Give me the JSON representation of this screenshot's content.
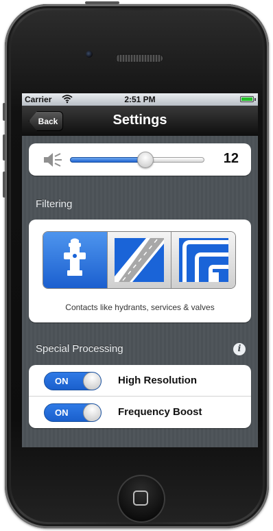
{
  "status_bar": {
    "carrier": "Carrier",
    "time": "2:51 PM",
    "wifi_icon": "wifi-icon",
    "battery_level": 1.0,
    "battery_color": "#26c02a"
  },
  "nav_bar": {
    "back_label": "Back",
    "title": "Settings"
  },
  "volume": {
    "icon": "speaker-muted-icon",
    "value_text": "12",
    "slider_fraction": 0.56
  },
  "filtering": {
    "section_label": "Filtering",
    "segments": [
      {
        "icon": "hydrant-icon",
        "selected": true
      },
      {
        "icon": "road-icon",
        "selected": false
      },
      {
        "icon": "pipes-icon",
        "selected": false
      }
    ],
    "caption": "Contacts like hydrants, services & valves"
  },
  "special_processing": {
    "section_label": "Special Processing",
    "info_icon": "info-icon",
    "toggles": [
      {
        "state_text": "ON",
        "label": "High Resolution"
      },
      {
        "state_text": "ON",
        "label": "Frequency Boost"
      }
    ]
  },
  "colors": {
    "accent_blue": "#1a64d8",
    "background": "#4d5358"
  }
}
